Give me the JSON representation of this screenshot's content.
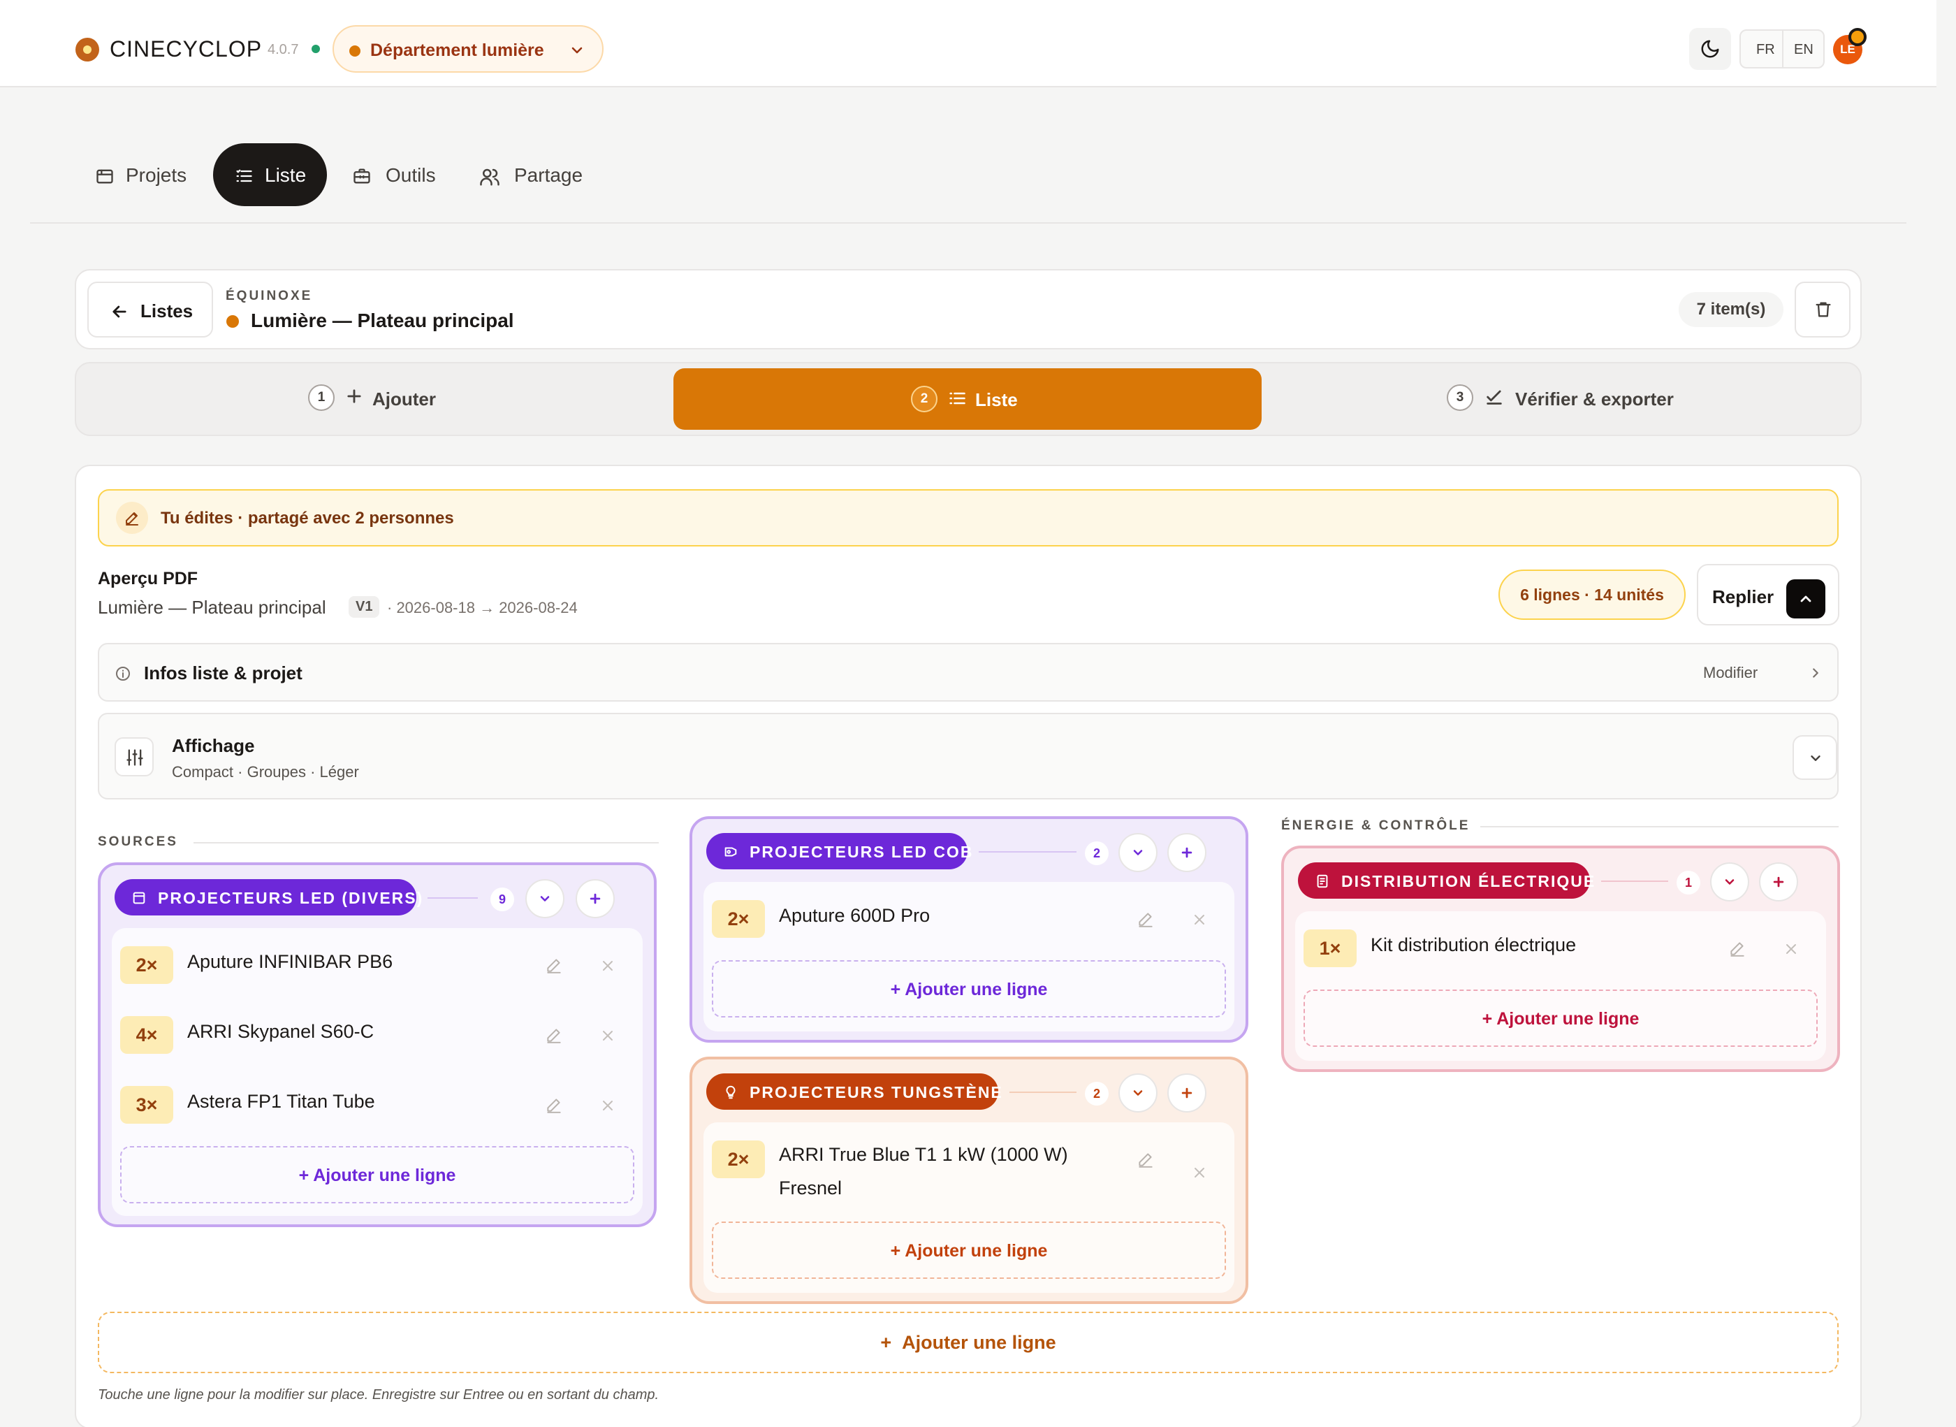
{
  "header": {
    "brand": "CINECYCLOP",
    "version": "4.0.7",
    "department": "Département lumière",
    "lang_fr": "FR",
    "lang_en": "EN",
    "avatar": "LE"
  },
  "nav": {
    "tabs": [
      {
        "label": "Projets",
        "icon": "projects-icon"
      },
      {
        "label": "Liste",
        "icon": "list-icon",
        "active": true
      },
      {
        "label": "Outils",
        "icon": "toolbox-icon"
      },
      {
        "label": "Partage",
        "icon": "users-icon"
      }
    ]
  },
  "list_header": {
    "back_label": "Listes",
    "project": "ÉQUINOXE",
    "name": "Lumière — Plateau principal",
    "item_count": "7 item(s)"
  },
  "steps": [
    {
      "num": "1",
      "label": "Ajouter"
    },
    {
      "num": "2",
      "label": "Liste",
      "active": true
    },
    {
      "num": "3",
      "label": "Vérifier & exporter"
    }
  ],
  "editor": {
    "banner": "Tu édites · partagé avec 2 personnes",
    "pdf_title": "Aperçu PDF",
    "pdf_subtitle": "Lumière — Plateau principal",
    "version_badge": "V1",
    "dates": "· 2026-08-18 → 2026-08-24",
    "summary": "6 lignes · 14 unités",
    "collapse_label": "Replier",
    "infos_title": "Infos liste & projet",
    "infos_action": "Modifier",
    "display_title": "Affichage",
    "display_sub": "Compact · Groupes · Léger"
  },
  "sections": {
    "sources": "SOURCES",
    "energy": "ÉNERGIE & CONTRÔLE"
  },
  "groups": [
    {
      "title": "PROJECTEURS LED (DIVERS)",
      "count": "9",
      "color": "#6d28d9",
      "items": [
        {
          "qty": "2×",
          "name": "Aputure INFINIBAR PB6"
        },
        {
          "qty": "4×",
          "name": "ARRI Skypanel S60-C"
        },
        {
          "qty": "3×",
          "name": "Astera FP1 Titan Tube"
        }
      ],
      "add_label": "Ajouter une ligne"
    },
    {
      "title": "PROJECTEURS LED COB",
      "count": "2",
      "color": "#6d28d9",
      "items": [
        {
          "qty": "2×",
          "name": "Aputure 600D Pro"
        }
      ],
      "add_label": "Ajouter une ligne"
    },
    {
      "title": "PROJECTEURS TUNGSTÈNE",
      "count": "2",
      "color": "#c2410c",
      "items": [
        {
          "qty": "2×",
          "name": "ARRI True Blue T1 1 kW (1000 W) Fresnel"
        }
      ],
      "add_label": "Ajouter une ligne"
    },
    {
      "title": "DISTRIBUTION ÉLECTRIQUE",
      "count": "1",
      "color": "#be123c",
      "items": [
        {
          "qty": "1×",
          "name": "Kit distribution électrique"
        }
      ],
      "add_label": "Ajouter une ligne"
    }
  ],
  "footer": {
    "add_label": "Ajouter une ligne",
    "hint": "Touche une ligne pour la modifier sur place. Enregistre sur Entree ou en sortant du champ."
  }
}
